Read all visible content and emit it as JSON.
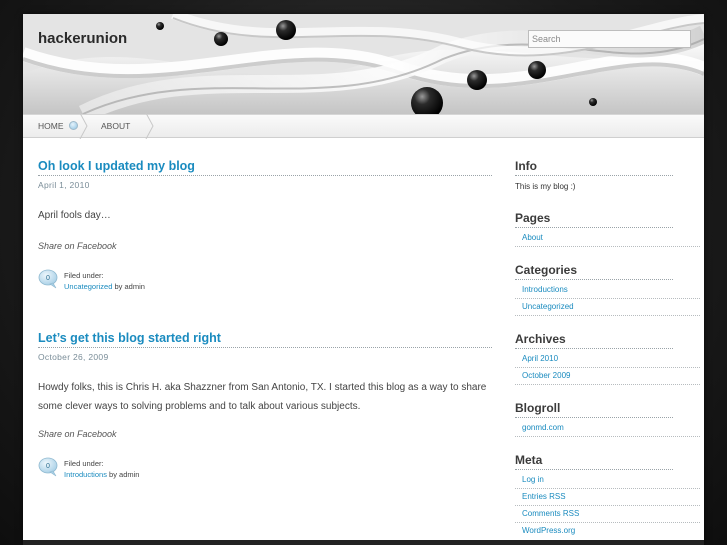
{
  "site": {
    "title": "hackerunion"
  },
  "search": {
    "placeholder": "Search"
  },
  "nav": {
    "items": [
      {
        "label": "HOME"
      },
      {
        "label": "ABOUT"
      }
    ]
  },
  "posts": [
    {
      "title": "Oh look I updated my blog",
      "date": "April 1, 2010",
      "body": "April fools day…",
      "share": "Share on Facebook",
      "comments": "0",
      "filed_label": "Filed under:",
      "category": "Uncategorized",
      "by": "by admin"
    },
    {
      "title": "Let’s get this blog started right",
      "date": "October 26, 2009",
      "body": "Howdy folks, this is Chris H. aka Shazzner from San Antonio, TX. I started this blog as a way to share some clever ways to solving problems and to talk about various subjects.",
      "share": "Share on Facebook",
      "comments": "0",
      "filed_label": "Filed under:",
      "category": "Introductions",
      "by": "by admin"
    }
  ],
  "sidebar": {
    "info": {
      "heading": "Info",
      "text": "This is my blog :)"
    },
    "pages": {
      "heading": "Pages",
      "items": [
        "About"
      ]
    },
    "categories": {
      "heading": "Categories",
      "items": [
        "Introductions",
        "Uncategorized"
      ]
    },
    "archives": {
      "heading": "Archives",
      "items": [
        "April 2010",
        "October 2009"
      ]
    },
    "blogroll": {
      "heading": "Blogroll",
      "items": [
        "gonmd.com"
      ]
    },
    "meta": {
      "heading": "Meta",
      "items": [
        "Log in",
        "Entries RSS",
        "Comments RSS",
        "WordPress.org"
      ]
    }
  },
  "colors": {
    "link": "#1a8bbf",
    "heading": "#3b3b3b",
    "background": "#1b1b1b"
  }
}
